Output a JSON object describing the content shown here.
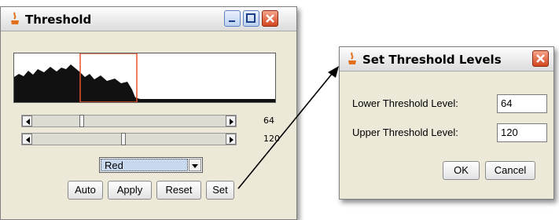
{
  "threshold_window": {
    "title": "Threshold",
    "lower_value": "64",
    "upper_value": "120",
    "channel_select": "Red",
    "buttons": {
      "auto": "Auto",
      "apply": "Apply",
      "reset": "Reset",
      "set": "Set"
    },
    "lower_slider_fraction": 0.251,
    "upper_slider_fraction": 0.471
  },
  "dialog": {
    "title": "Set Threshold Levels",
    "lower_label": "Lower Threshold Level:",
    "lower_value": "64",
    "upper_label": "Upper Threshold Level:",
    "upper_value": "120",
    "ok_label": "OK",
    "cancel_label": "Cancel"
  },
  "colors": {
    "selection_box": "#e8532a",
    "titlebar_red": "#d2451e",
    "window_bg": "#ece9d8"
  },
  "icons": [
    "java-cup-icon",
    "minimize-icon",
    "maximize-icon",
    "close-icon",
    "arrow-left-icon",
    "arrow-right-icon",
    "chevron-down-icon"
  ]
}
